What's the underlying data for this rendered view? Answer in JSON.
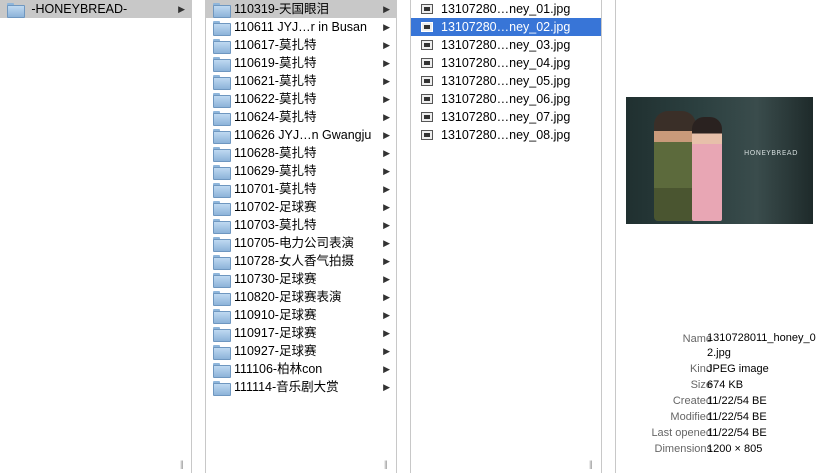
{
  "column1": {
    "items": [
      {
        "label": "-HONEYBREAD-",
        "has_children": true,
        "active": true
      }
    ]
  },
  "column2": {
    "items": [
      {
        "label": "110319-天国眼泪",
        "active": true
      },
      {
        "label": "110611 JYJ…r in Busan"
      },
      {
        "label": "110617-莫扎特"
      },
      {
        "label": "110619-莫扎特"
      },
      {
        "label": "110621-莫扎特"
      },
      {
        "label": "110622-莫扎特"
      },
      {
        "label": "110624-莫扎特"
      },
      {
        "label": "110626 JYJ…n Gwangju"
      },
      {
        "label": "110628-莫扎特"
      },
      {
        "label": "110629-莫扎特"
      },
      {
        "label": "110701-莫扎特"
      },
      {
        "label": "110702-足球赛"
      },
      {
        "label": "110703-莫扎特"
      },
      {
        "label": "110705-电力公司表演"
      },
      {
        "label": "110728-女人香气拍摄"
      },
      {
        "label": "110730-足球赛"
      },
      {
        "label": "110820-足球赛表演"
      },
      {
        "label": "110910-足球赛"
      },
      {
        "label": "110917-足球赛"
      },
      {
        "label": "110927-足球赛"
      },
      {
        "label": "111106-柏林con"
      },
      {
        "label": "111114-音乐剧大赏"
      }
    ]
  },
  "column3": {
    "items": [
      {
        "label": "13107280…ney_01.jpg"
      },
      {
        "label": "13107280…ney_02.jpg",
        "selected": true
      },
      {
        "label": "13107280…ney_03.jpg"
      },
      {
        "label": "13107280…ney_04.jpg"
      },
      {
        "label": "13107280…ney_05.jpg"
      },
      {
        "label": "13107280…ney_06.jpg"
      },
      {
        "label": "13107280…ney_07.jpg"
      },
      {
        "label": "13107280…ney_08.jpg"
      }
    ]
  },
  "preview": {
    "image_logo": "HONEYBREAD",
    "info": {
      "name_label": "Name",
      "name_value": "1310728011_honey_02.jpg",
      "kind_label": "Kind",
      "kind_value": "JPEG image",
      "size_label": "Size",
      "size_value": "674 KB",
      "created_label": "Created",
      "created_value": "11/22/54 BE",
      "modified_label": "Modified",
      "modified_value": "11/22/54 BE",
      "opened_label": "Last opened",
      "opened_value": "11/22/54 BE",
      "dimensions_label": "Dimensions",
      "dimensions_value": "1200 × 805"
    }
  },
  "icons": {
    "arrow": "▶",
    "resize": "||"
  },
  "colors": {
    "selection": "#3875d7",
    "active_path": "#c8c8c8"
  }
}
